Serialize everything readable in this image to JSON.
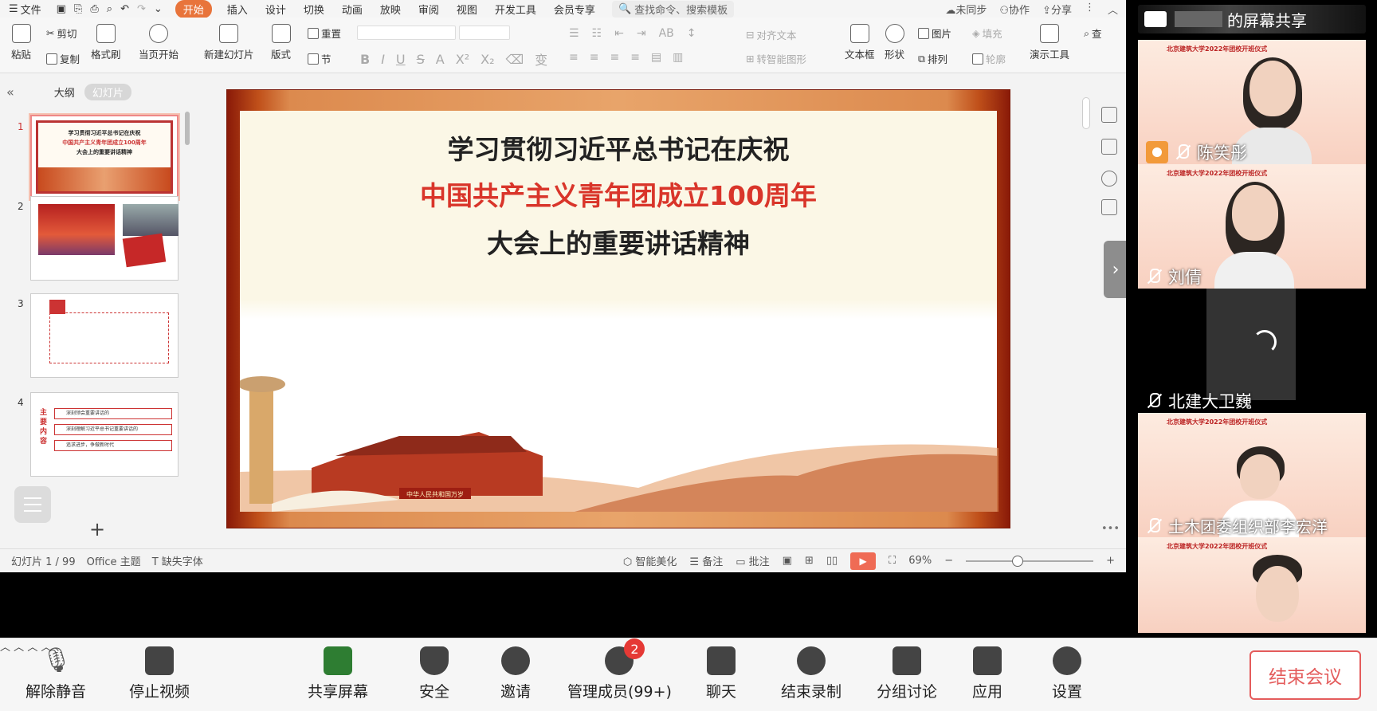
{
  "menubar": {
    "file": "文件",
    "tabs": [
      "开始",
      "插入",
      "设计",
      "切换",
      "动画",
      "放映",
      "审阅",
      "视图",
      "开发工具",
      "会员专享"
    ],
    "active_tab": "开始",
    "search_placeholder": "查找命令、搜索模板",
    "right": [
      "未同步",
      "协作",
      "分享"
    ]
  },
  "ribbon": {
    "paste": "粘贴",
    "cut": "剪切",
    "copy": "复制",
    "format_painter": "格式刷",
    "from_current": "当页开始",
    "new_slide": "新建幻灯片",
    "layout": "版式",
    "reset": "重置",
    "section": "节",
    "align_text": "对齐文本",
    "to_smartart": "转智能图形",
    "textbox": "文本框",
    "shape": "形状",
    "picture": "图片",
    "fill": "填充",
    "arrange": "排列",
    "outline": "轮廓",
    "present_tools": "演示工具",
    "find": "查"
  },
  "thumbs_panel": {
    "tab_outline": "大纲",
    "tab_slides": "幻灯片",
    "selected": 1,
    "items": [
      {
        "num": "1",
        "lines": [
          "学习贯彻习近平总书记在庆祝",
          "中国共产主义青年团成立100周年",
          "大会上的重要讲话精神"
        ]
      },
      {
        "num": "2"
      },
      {
        "num": "3"
      },
      {
        "num": "4",
        "items": [
          "深刻领会重要讲话的",
          "深刻理解习近平总书记重要讲话的",
          "追求进步，争做新时代"
        ]
      }
    ]
  },
  "slide": {
    "line1": "学习贯彻习近平总书记在庆祝",
    "line2": "中国共产主义青年团成立100周年",
    "line3": "大会上的重要讲话精神",
    "gate_plaque": "中华人民共和国万岁",
    "line2_color": "#d9352a"
  },
  "statusbar": {
    "slide_count": "幻灯片 1 / 99",
    "theme": "Office 主题",
    "missing_font": "缺失字体",
    "smart_beautify": "智能美化",
    "notes": "备注",
    "comments": "批注",
    "zoom": "69%"
  },
  "video_panel": {
    "share_title": "的屏幕共享",
    "tile_header": "北京建筑大学2022年团校开班仪式",
    "participants": [
      "陈笑彤",
      "刘倩",
      "北建大卫巍",
      "土木团委组织部李宏洋",
      ""
    ]
  },
  "meeting_toolbar": {
    "unmute": "解除静音",
    "stop_video": "停止视频",
    "share_screen": "共享屏幕",
    "security": "安全",
    "invite": "邀请",
    "manage_members": "管理成员(99+)",
    "members_badge": "2",
    "chat": "聊天",
    "end_record": "结束录制",
    "breakout": "分组讨论",
    "apps": "应用",
    "settings": "设置",
    "end_meeting": "结束会议"
  }
}
